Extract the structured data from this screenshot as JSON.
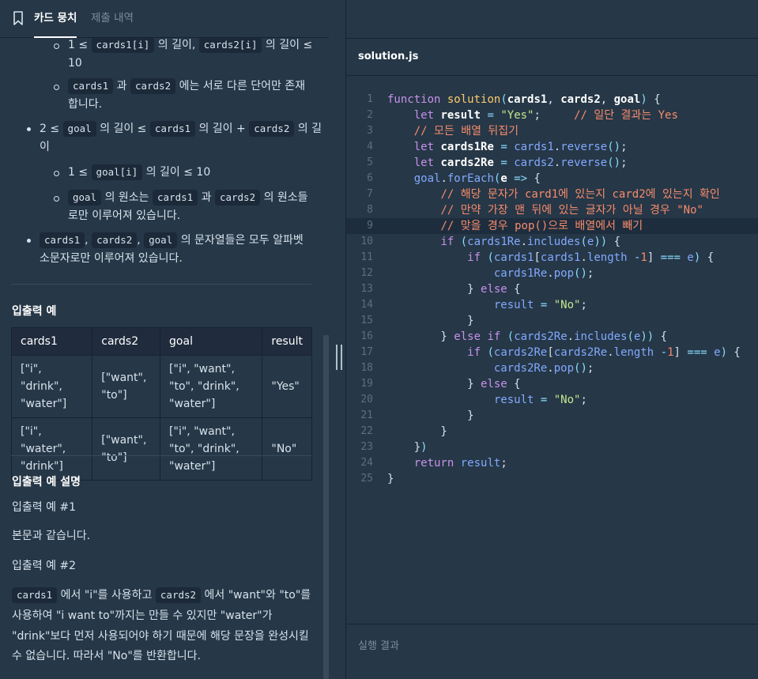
{
  "tabs": {
    "active": "카드 뭉치",
    "inactive": "제출 내역"
  },
  "desc": {
    "c1_l1_pre": "1 ≤",
    "c1_l1_code1": "cards1[i]",
    "c1_l1_mid": "의 길이,",
    "c1_l1_code2": "cards2[i]",
    "c1_l1_post": "의 길이 ≤",
    "c1_l2": "10",
    "c2_code1": "cards1",
    "c2_mid": "과",
    "c2_code2": "cards2",
    "c2_post": "에는 서로 다른 단어만 존재",
    "c2_l2": "합니다.",
    "b1_pre": "2 ≤",
    "b1_code1": "goal",
    "b1_mid1": "의 길이 ≤",
    "b1_code2": "cards1",
    "b1_mid2": "의 길이 +",
    "b1_code3": "cards2",
    "b1_post": "의 길",
    "b1_l2": "이",
    "c3_pre": "1 ≤",
    "c3_code": "goal[i]",
    "c3_post": "의 길이 ≤ 10",
    "c4_code1": "goal",
    "c4_mid1": "의 원소는",
    "c4_code2": "cards1",
    "c4_mid2": "과",
    "c4_code3": "cards2",
    "c4_post": "의 원소들",
    "c4_l2": "로만 이루어져 있습니다.",
    "b2_code1": "cards1",
    "b2_sep1": ",",
    "b2_code2": "cards2",
    "b2_sep2": ",",
    "b2_code3": "goal",
    "b2_post": "의 문자열들은 모두 알파벳",
    "b2_l2": "소문자로만 이루어져 있습니다."
  },
  "io_heading": "입출력 예",
  "io_table": {
    "headers": [
      "cards1",
      "cards2",
      "goal",
      "result"
    ],
    "rows": [
      [
        "[\"i\", \"drink\", \"water\"]",
        "[\"want\", \"to\"]",
        "[\"i\", \"want\", \"to\", \"drink\", \"water\"]",
        "\"Yes\""
      ],
      [
        "[\"i\", \"water\", \"drink\"]",
        "[\"want\", \"to\"]",
        "[\"i\", \"want\", \"to\", \"drink\", \"water\"]",
        "\"No\""
      ]
    ]
  },
  "explain": {
    "heading": "입출력 예 설명",
    "ex1": "입출력 예 #1",
    "ex1_body": "본문과 같습니다.",
    "ex2": "입출력 예 #2",
    "p_code1": "cards1",
    "p_l1a": "에서 \"i\"를 사용하고",
    "p_code2": "cards2",
    "p_l1b": "에서 \"want\"와 \"to\"를",
    "p_l2": "사용하여 \"i want to\"까지는 만들 수 있지만 \"water\"가",
    "p_l3": "\"drink\"보다 먼저 사용되어야 하기 때문에 해당 문장을 완성시킬",
    "p_l4": "수 없습니다. 따라서 \"No\"를 반환합니다."
  },
  "editor": {
    "filename": "solution.js",
    "line_numbers": [
      "1",
      "2",
      "3",
      "4",
      "5",
      "6",
      "7",
      "8",
      "9",
      "10",
      "11",
      "12",
      "13",
      "14",
      "15",
      "16",
      "17",
      "18",
      "19",
      "20",
      "21",
      "22",
      "23",
      "24",
      "25"
    ],
    "code": {
      "l1a": "function",
      "l1b": "solution",
      "l1c": "cards1",
      "l1d": "cards2",
      "l1e": "goal",
      "l2a": "let",
      "l2b": "result",
      "l2c": "\"Yes\"",
      "l2d": "// 일단 결과는 Yes",
      "l3": "// 모든 배열 뒤집기",
      "l4a": "let",
      "l4b": "cards1Re",
      "l4c": "cards1",
      "l4d": "reverse",
      "l5a": "let",
      "l5b": "cards2Re",
      "l5c": "cards2",
      "l5d": "reverse",
      "l6a": "goal",
      "l6b": "forEach",
      "l6c": "e",
      "l7": "// 해당 문자가 card1에 있는지 card2에 있는지 확인",
      "l8": "// 만약 가장 맨 뒤에 있는 글자가 아닐 경우 \"No\"",
      "l9": "// 맞을 경우 pop()으로 배열에서 빼기",
      "l10a": "if",
      "l10b": "cards1Re",
      "l10c": "includes",
      "l10d": "e",
      "l11a": "if",
      "l11b": "cards1",
      "l11c": "cards1",
      "l11d": "length",
      "l11e": "1",
      "l11f": "e",
      "l12a": "cards1Re",
      "l12b": "pop",
      "l13a": "else",
      "l14a": "result",
      "l14b": "\"No\"",
      "l16a": "else",
      "l16b": "if",
      "l16c": "cards2Re",
      "l16d": "includes",
      "l16e": "e",
      "l17a": "if",
      "l17b": "cards2Re",
      "l17c": "cards2Re",
      "l17d": "length",
      "l17e": "1",
      "l17f": "e",
      "l18a": "cards2Re",
      "l18b": "pop",
      "l19a": "else",
      "l20a": "result",
      "l20b": "\"No\"",
      "l24a": "return",
      "l24b": "result"
    }
  },
  "result_panel": {
    "title": "실행 결과"
  }
}
